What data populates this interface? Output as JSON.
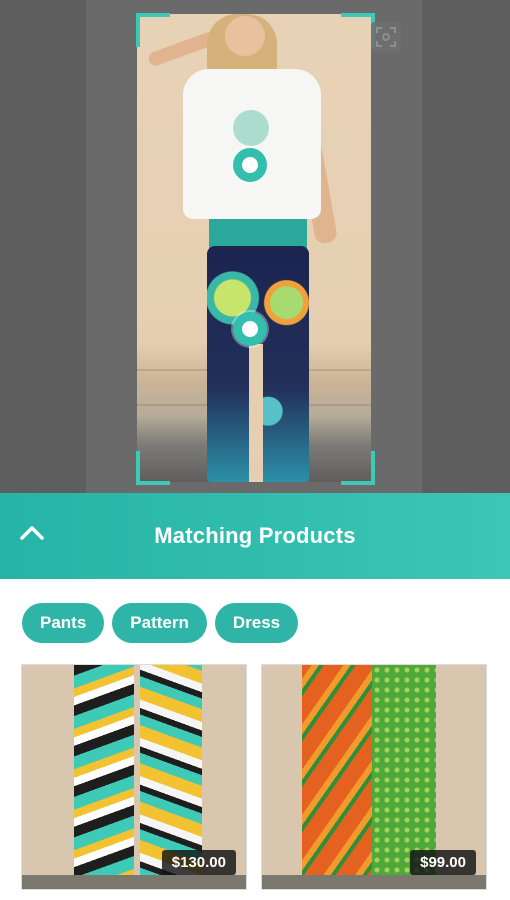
{
  "colors": {
    "accent": "#32bfae",
    "header_start": "#25b4a6",
    "header_end": "#3cc6b5",
    "tag_bg": "#2fb4a8"
  },
  "viewer": {
    "hotspots": [
      "top-hotspot",
      "bottom-hotspot"
    ],
    "scan_icon": "scan-icon"
  },
  "panel": {
    "collapse_icon": "chevron-up-icon",
    "title": "Matching Products"
  },
  "tags": [
    "Pants",
    "Pattern",
    "Dress"
  ],
  "products": [
    {
      "price": "$130.00"
    },
    {
      "price": "$99.00"
    }
  ]
}
